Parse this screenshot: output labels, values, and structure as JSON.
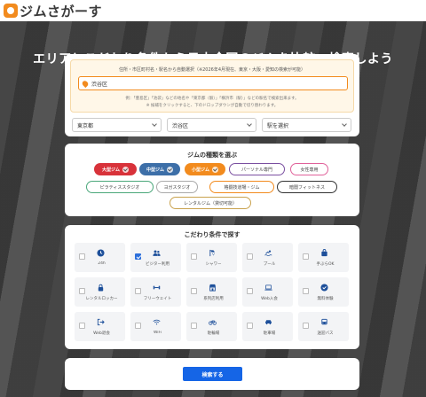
{
  "logo": {
    "text": "ジムさがーす"
  },
  "hero": {
    "title": "エリアとこだわり条件から日本全国のジムを比較・検索しよう"
  },
  "location": {
    "notice_line1": "住所・市区町村名・駅名から自動選択（※2026年4月現在、東京・大阪・愛知の検索が可能）",
    "input_value": "渋谷区",
    "hint_line1": "例：「豊島区」「池袋」などの地名や「東京都（駅）」「横浜市（駅）」などの駅名で検索出来ます。",
    "hint_line2": "※ 候補をクリックすると、下のドロップダウンが自動で切り替わります。",
    "prefecture_select": "東京都",
    "city_select": "渋谷区",
    "station_select": "駅を選択"
  },
  "gym_types": {
    "title": "ジムの種類を選ぶ",
    "tags": [
      {
        "label": "大型ジム",
        "selected": true,
        "color": "#d8323a"
      },
      {
        "label": "中型ジム",
        "selected": true,
        "color": "#3d6fa8"
      },
      {
        "label": "小型ジム",
        "selected": true,
        "color": "#f28b1e"
      },
      {
        "label": "パーソナル専門",
        "selected": false,
        "color": "#7a4fa0"
      },
      {
        "label": "女性専用",
        "selected": false,
        "color": "#e0619a"
      },
      {
        "label": "ピラティススタジオ",
        "selected": false,
        "color": "#4aa77a"
      },
      {
        "label": "ヨガスタジオ",
        "selected": false,
        "color": "#aaaaaa"
      },
      {
        "label": "格闘技道場・ジム",
        "selected": false,
        "color": "#f28b1e"
      },
      {
        "label": "暗闇フィットネス",
        "selected": false,
        "color": "#333333"
      },
      {
        "label": "レンタルジム（貸切可能）",
        "selected": false,
        "color": "#c9a24e"
      }
    ]
  },
  "conditions": {
    "title": "こだわり条件で探す",
    "items": [
      {
        "label": "24h",
        "icon": "clock-icon",
        "checked": false
      },
      {
        "label": "ビジター利用",
        "icon": "users-icon",
        "checked": true
      },
      {
        "label": "シャワー",
        "icon": "shower-icon",
        "checked": false
      },
      {
        "label": "プール",
        "icon": "pool-icon",
        "checked": false
      },
      {
        "label": "手ぶらOK",
        "icon": "bag-icon",
        "checked": false
      },
      {
        "label": "レンタルロッカー",
        "icon": "lock-icon",
        "checked": false
      },
      {
        "label": "フリーウェイト",
        "icon": "dumbbell-icon",
        "checked": false
      },
      {
        "label": "系列店利用",
        "icon": "store-icon",
        "checked": false
      },
      {
        "label": "Web入会",
        "icon": "laptop-icon",
        "checked": false
      },
      {
        "label": "無料体験",
        "icon": "badge-check-icon",
        "checked": false
      },
      {
        "label": "Web退会",
        "icon": "logout-icon",
        "checked": false
      },
      {
        "label": "WiFi",
        "icon": "wifi-icon",
        "checked": false
      },
      {
        "label": "駐輪場",
        "icon": "bicycle-icon",
        "checked": false
      },
      {
        "label": "駐車場",
        "icon": "car-icon",
        "checked": false
      },
      {
        "label": "送迎バス",
        "icon": "bus-icon",
        "checked": false
      }
    ]
  },
  "search": {
    "button_label": "検索する"
  },
  "colors": {
    "accent": "#f28b1e",
    "primary": "#1565e6"
  }
}
